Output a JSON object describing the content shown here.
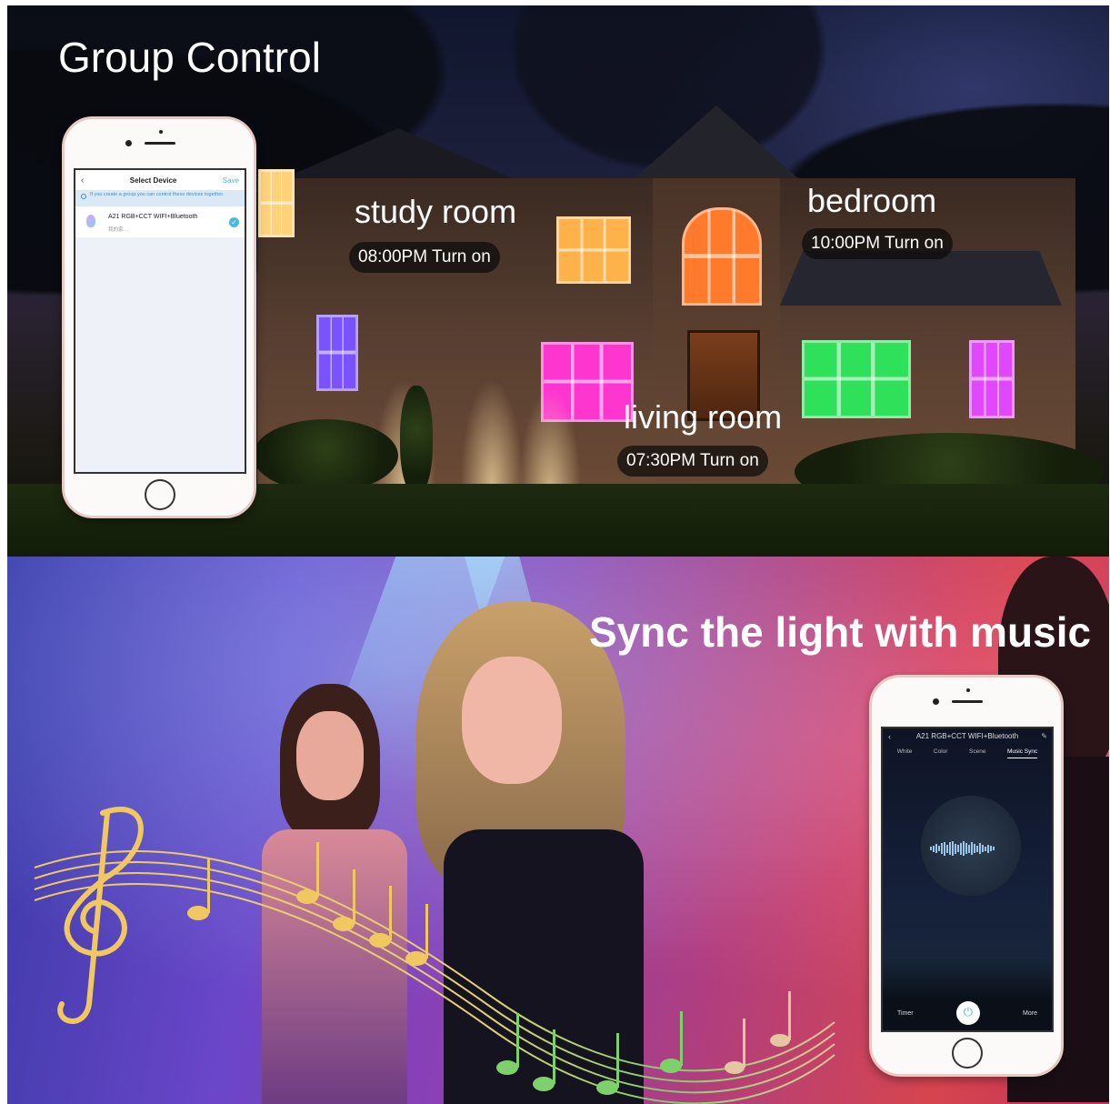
{
  "group_section": {
    "title": "Group Control",
    "rooms": [
      {
        "name": "study room",
        "time": "08:00PM Turn on"
      },
      {
        "name": "bedroom",
        "time": "10:00PM Turn on"
      },
      {
        "name": "living room",
        "time": "07:30PM Turn on"
      }
    ],
    "phone_app": {
      "back_icon": "chevron-left-icon",
      "nav_title": "Select Device",
      "save_label": "Save",
      "info_text": "If you create a group you can control these devices together.",
      "device": {
        "name": "A21 RGB+CCT WIFI+Bluetooth",
        "subtitle": "我的家 ...",
        "selected": true
      }
    }
  },
  "music_section": {
    "title": "Sync the light with music",
    "phone_app": {
      "device_title": "A21 RGB+CCT WIFI+Bluetooth",
      "tabs": [
        "White",
        "Color",
        "Scene",
        "Music Sync"
      ],
      "active_tab": "Music Sync",
      "timer_label": "Timer",
      "more_label": "More",
      "power_icon": "power-icon"
    }
  },
  "window_colors": [
    "#ffd27a",
    "#ff8a2e",
    "#7a52ff",
    "#ff35d0",
    "#2ee05a",
    "#e048ff"
  ]
}
